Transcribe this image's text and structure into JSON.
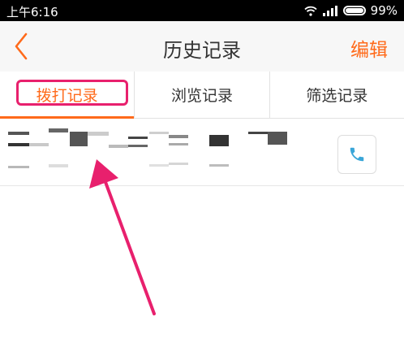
{
  "status_bar": {
    "time": "上午6:16",
    "battery": "99%"
  },
  "header": {
    "title": "历史记录",
    "edit_label": "编辑"
  },
  "tabs": [
    {
      "label": "拨打记录",
      "active": true
    },
    {
      "label": "浏览记录",
      "active": false
    },
    {
      "label": "筛选记录",
      "active": false
    }
  ],
  "colors": {
    "accent": "#ff6a1a",
    "annotation": "#e8206d",
    "phone_icon": "#3aa6d8"
  },
  "icons": {
    "back": "chevron-left-icon",
    "call": "phone-icon"
  }
}
